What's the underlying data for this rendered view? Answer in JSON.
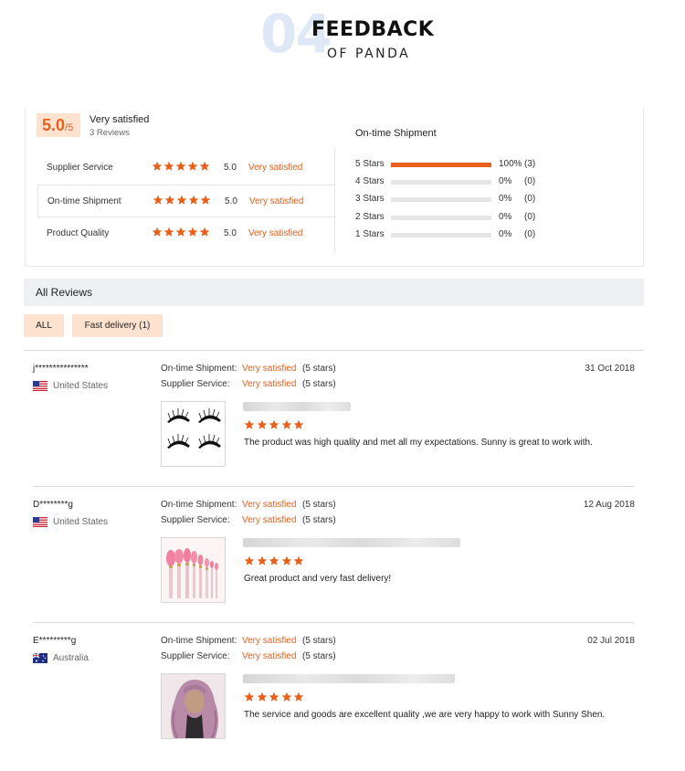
{
  "header": {
    "number": "04",
    "title": "FEEDBACK",
    "subtitle": "OF PANDA"
  },
  "summary": {
    "score": "5.0",
    "score_suffix": "/5",
    "overall_label": "Very satisfied",
    "review_count": "3 Reviews",
    "categories": [
      {
        "label": "Supplier Service",
        "score": "5.0",
        "status": "Very satisfied",
        "stars": 5
      },
      {
        "label": "On-time Shipment",
        "score": "5.0",
        "status": "Very satisfied",
        "stars": 5
      },
      {
        "label": "Product Quality",
        "score": "5.0",
        "status": "Very satisfied",
        "stars": 5
      }
    ],
    "distribution_title": "On-time Shipment",
    "distribution": [
      {
        "label": "5 Stars",
        "percent": "100%",
        "count": "(3)",
        "fill": 1.0
      },
      {
        "label": "4 Stars",
        "percent": "0%",
        "count": "(0)",
        "fill": 0
      },
      {
        "label": "3 Stars",
        "percent": "0%",
        "count": "(0)",
        "fill": 0
      },
      {
        "label": "2 Stars",
        "percent": "0%",
        "count": "(0)",
        "fill": 0
      },
      {
        "label": "1 Stars",
        "percent": "0%",
        "count": "(0)",
        "fill": 0
      }
    ]
  },
  "reviews_section": {
    "title": "All Reviews",
    "filters": [
      {
        "label": "ALL"
      },
      {
        "label": "Fast delivery (1)"
      }
    ]
  },
  "reviews": [
    {
      "user": "j***************",
      "country": "United States",
      "flag": "us",
      "shipment_label": "On-time Shipment:",
      "shipment_value": "Very satisfied",
      "shipment_stars": "(5 stars)",
      "service_label": "Supplier Service:",
      "service_value": "Very satisfied",
      "service_stars": "(5 stars)",
      "date": "31 Oct 2018",
      "rating": 5,
      "text": "The product was high quality and met all my expectations. Sunny is great to work with.",
      "image": "lashes"
    },
    {
      "user": "D********g",
      "country": "United States",
      "flag": "us",
      "shipment_label": "On-time Shipment:",
      "shipment_value": "Very satisfied",
      "shipment_stars": "(5 stars)",
      "service_label": "Supplier Service:",
      "service_value": "Very satisfied",
      "service_stars": "(5 stars)",
      "date": "12 Aug 2018",
      "rating": 5,
      "text": "Great product and very fast delivery!",
      "image": "brushes"
    },
    {
      "user": "E*********g",
      "country": "Australia",
      "flag": "au",
      "shipment_label": "On-time Shipment:",
      "shipment_value": "Very satisfied",
      "shipment_stars": "(5 stars)",
      "service_label": "Supplier Service:",
      "service_value": "Very satisfied",
      "service_stars": "(5 stars)",
      "date": "02 Jul 2018",
      "rating": 5,
      "text": "The service and goods are excellent quality ,we are very happy to work with Sunny Shen.",
      "image": "wig"
    }
  ],
  "colors": {
    "accent": "#e8601c",
    "badge_bg": "#fde2d0",
    "section_bg": "#eef0f3"
  }
}
